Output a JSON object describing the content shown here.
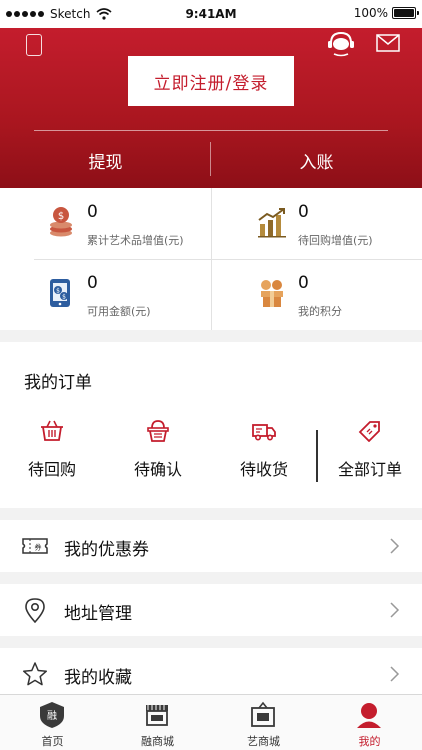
{
  "status_bar": {
    "carrier": "Sketch",
    "time": "9:41AM",
    "battery": "100%"
  },
  "header": {
    "login_label": "立即注册/登录",
    "withdraw_label": "提现",
    "deposit_label": "入账",
    "icons": [
      "phone-icon",
      "customer-service-icon",
      "mail-icon"
    ]
  },
  "stats": [
    {
      "value": "0",
      "label": "累计艺术品增值(元)",
      "icon": "coin-stack-icon"
    },
    {
      "value": "0",
      "label": "待回购增值(元)",
      "icon": "bar-chart-growth-icon"
    },
    {
      "value": "0",
      "label": "可用金额(元)",
      "icon": "mobile-money-icon"
    },
    {
      "value": "0",
      "label": "我的积分",
      "icon": "gift-points-icon"
    }
  ],
  "orders": {
    "title": "我的订单",
    "items": [
      {
        "label": "待回购",
        "icon": "basket-icon"
      },
      {
        "label": "待确认",
        "icon": "shopping-basket-icon"
      },
      {
        "label": "待收货",
        "icon": "delivery-truck-icon"
      },
      {
        "label": "全部订单",
        "icon": "price-tag-icon"
      }
    ]
  },
  "menu": [
    {
      "label": "我的优惠券",
      "icon": "coupon-icon"
    },
    {
      "label": "地址管理",
      "icon": "location-pin-icon"
    },
    {
      "label": "我的收藏",
      "icon": "star-icon"
    }
  ],
  "tabbar": [
    {
      "label": "首页",
      "icon": "home-badge-icon",
      "active": false
    },
    {
      "label": "融商城",
      "icon": "storefront-icon",
      "active": false
    },
    {
      "label": "艺商城",
      "icon": "picture-frame-icon",
      "active": false
    },
    {
      "label": "我的",
      "icon": "profile-icon",
      "active": true
    }
  ],
  "colors": {
    "brand_red": "#c41d2d",
    "background_gray": "#f2f2f2"
  }
}
